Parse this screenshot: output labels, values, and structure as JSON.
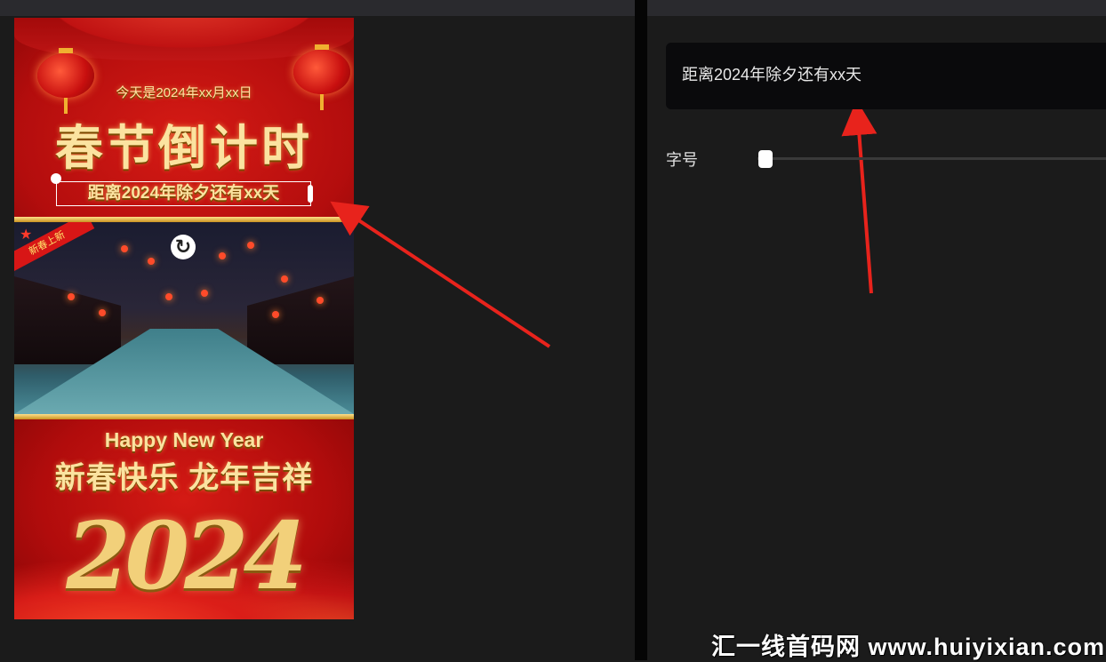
{
  "poster": {
    "date_line": "今天是2024年xx月xx日",
    "title": "春节倒计时",
    "countdown_text": "距离2024年除夕还有xx天",
    "ribbon_text": "新春上新",
    "greeting_en": "Happy New Year",
    "blessing": "新春快乐 龙年吉祥",
    "year_art": "2024"
  },
  "editor": {
    "text_value": "距离2024年除夕还有xx天",
    "font_size_label": "字号",
    "font_size_level": 0.01
  },
  "watermark": "汇一线首码网 www.huiyixian.com",
  "colors": {
    "annotation_arrow": "#e8231c",
    "poster_red": "#c01212",
    "poster_gold": "#fbe3a0",
    "panel_bg": "#1b1b1b",
    "field_bg": "#0a0a0c"
  }
}
